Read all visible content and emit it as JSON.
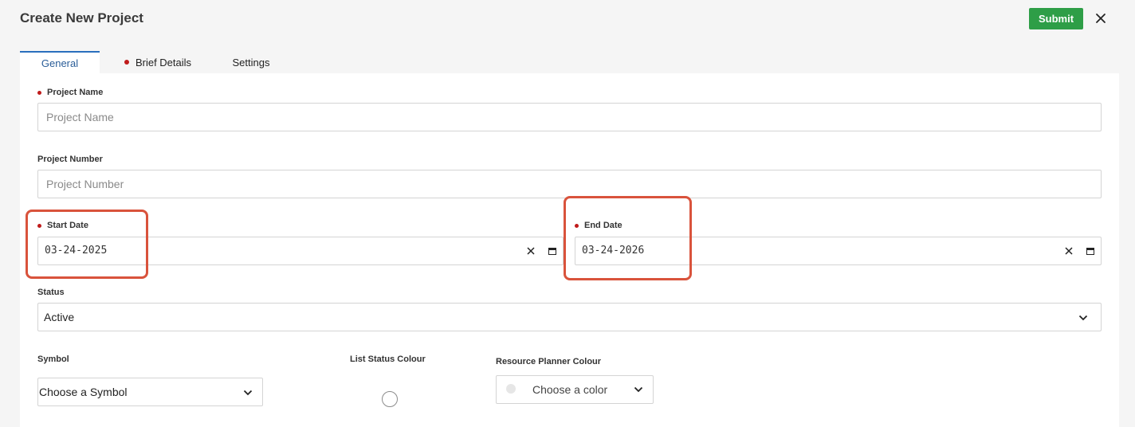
{
  "header": {
    "title": "Create New Project",
    "submit_label": "Submit",
    "submit_color": "#2e9e47"
  },
  "tabs": [
    {
      "label": "General",
      "active": true,
      "required": false
    },
    {
      "label": "Brief Details",
      "active": false,
      "required": true
    },
    {
      "label": "Settings",
      "active": false,
      "required": false
    }
  ],
  "form": {
    "project_name": {
      "label": "Project Name",
      "required": true,
      "value": "",
      "placeholder": "Project Name"
    },
    "project_number": {
      "label": "Project Number",
      "required": false,
      "value": "",
      "placeholder": "Project Number"
    },
    "start_date": {
      "label": "Start Date",
      "required": true,
      "value": "03-24-2025"
    },
    "end_date": {
      "label": "End Date",
      "required": true,
      "value": "03-24-2026"
    },
    "status": {
      "label": "Status",
      "value": "Active"
    },
    "symbol": {
      "label": "Symbol",
      "value": "Choose a Symbol"
    },
    "list_status_colour": {
      "label": "List Status Colour"
    },
    "resource_planner_colour": {
      "label": "Resource Planner Colour",
      "value": "Choose a color"
    }
  },
  "icons": {
    "close": "close-icon",
    "clear": "clear-icon",
    "calendar": "calendar-icon",
    "chevron": "chevron-down-icon"
  },
  "colors": {
    "required_dot": "#c01b1b",
    "active_tab": "#2a6fbd",
    "highlight": "#d9533c"
  }
}
